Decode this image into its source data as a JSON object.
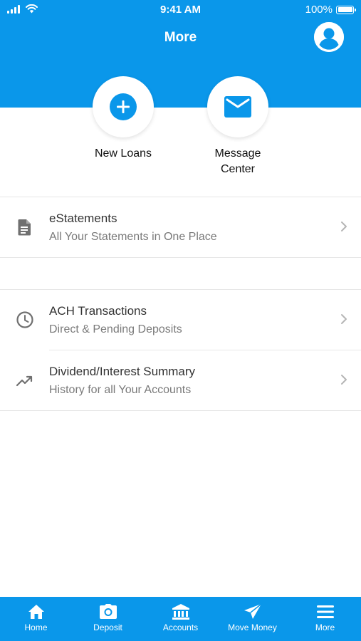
{
  "status_bar": {
    "time": "9:41 AM",
    "battery": "100%"
  },
  "header": {
    "title": "More"
  },
  "quick_actions": [
    {
      "label": "New Loans",
      "icon": "plus-circle-icon"
    },
    {
      "label": "Message\nCenter",
      "icon": "mail-icon"
    }
  ],
  "menu": [
    {
      "title": "eStatements",
      "subtitle": "All Your Statements in One Place",
      "icon": "document-icon"
    },
    {
      "title": "ACH Transactions",
      "subtitle": "Direct & Pending Deposits",
      "icon": "clock-icon"
    },
    {
      "title": "Dividend/Interest Summary",
      "subtitle": "History for all Your Accounts",
      "icon": "trending-up-icon"
    }
  ],
  "tabs": [
    {
      "label": "Home",
      "icon": "home-icon"
    },
    {
      "label": "Deposit",
      "icon": "camera-icon"
    },
    {
      "label": "Accounts",
      "icon": "bank-icon"
    },
    {
      "label": "Move Money",
      "icon": "send-icon"
    },
    {
      "label": "More",
      "icon": "menu-icon",
      "active": true
    }
  ],
  "colors": {
    "brand": "#0a97ea",
    "text": "#333333",
    "subtext": "#7a7a7a"
  }
}
